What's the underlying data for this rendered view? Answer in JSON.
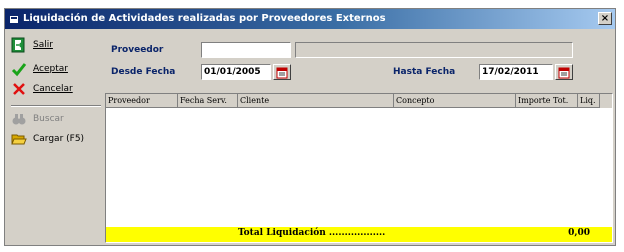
{
  "window": {
    "title": "Liquidación de Actividades realizadas por Proveedores Externos",
    "close_glyph": "×"
  },
  "sidebar": {
    "salir": "Salir",
    "aceptar": "Aceptar",
    "cancelar": "Cancelar",
    "buscar": "Buscar",
    "cargar": "Cargar (F5)"
  },
  "form": {
    "proveedor_label": "Proveedor",
    "proveedor_value": "",
    "desde_label": "Desde Fecha",
    "desde_value": "01/01/2005",
    "hasta_label": "Hasta Fecha",
    "hasta_value": "17/02/2011"
  },
  "grid": {
    "columns": [
      "Proveedor",
      "Fecha Serv.",
      "Cliente",
      "Concepto",
      "Importe Tot.",
      "Liq."
    ]
  },
  "total": {
    "label": "Total Liquidación ..................",
    "value": "0,00"
  },
  "colors": {
    "accent": "#0a246a",
    "total_bg": "#ffff00"
  }
}
